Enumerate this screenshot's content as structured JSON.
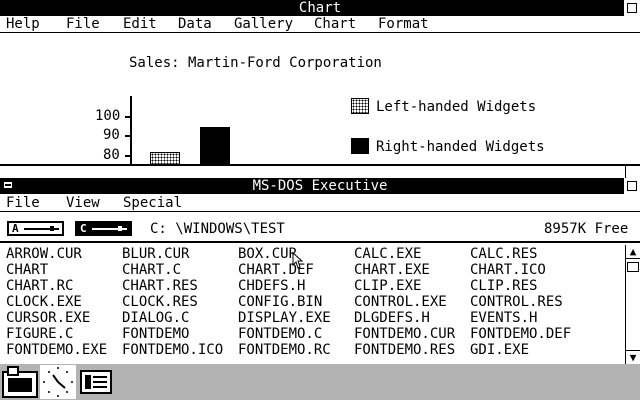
{
  "chart_window": {
    "title": "Chart",
    "menu": [
      "Help",
      "File",
      "Edit",
      "Data",
      "Gallery",
      "Chart",
      "Format"
    ]
  },
  "chart_data": {
    "type": "bar",
    "title": "Sales: Martin-Ford Corporation",
    "yticks": [
      "100",
      "90",
      "80"
    ],
    "series": [
      {
        "name": "Left-handed Widgets",
        "values": [
          81
        ]
      },
      {
        "name": "Right-handed Widgets",
        "values": [
          94
        ]
      }
    ],
    "ylim": [
      75,
      105
    ],
    "legend_position": "right",
    "colors": {
      "Left-handed Widgets": "light dot pattern",
      "Right-handed Widgets": "dense dot pattern"
    }
  },
  "dos_window": {
    "title": "MS-DOS Executive",
    "menu": [
      "File",
      "View",
      "Special"
    ],
    "drives": [
      "A",
      "C"
    ],
    "selected_drive": "C",
    "path": "C: \\WINDOWS\\TEST",
    "free_space": "8957K Free",
    "files": [
      [
        "ARROW.CUR",
        "BLUR.CUR",
        "BOX.CUR",
        "CALC.EXE",
        "CALC.RES"
      ],
      [
        "CHART",
        "CHART.C",
        "CHART.DEF",
        "CHART.EXE",
        "CHART.ICO"
      ],
      [
        "CHART.RC",
        "CHART.RES",
        "CHDEFS.H",
        "CLIP.EXE",
        "CLIP.RES"
      ],
      [
        "CLOCK.EXE",
        "CLOCK.RES",
        "CONFIG.BIN",
        "CONTROL.EXE",
        "CONTROL.RES"
      ],
      [
        "CURSOR.EXE",
        "DIALOG.C",
        "DISPLAY.EXE",
        "DLGDEFS.H",
        "EVENTS.H"
      ],
      [
        "FIGURE.C",
        "FONTDEMO",
        "FONTDEMO.C",
        "FONTDEMO.CUR",
        "FONTDEMO.DEF"
      ],
      [
        "FONTDEMO.EXE",
        "FONTDEMO.ICO",
        "FONTDEMO.RC",
        "FONTDEMO.RES",
        "GDI.EXE"
      ]
    ]
  },
  "icon_bar": {
    "icons": [
      "file-cabinet-icon",
      "clock-icon",
      "ms-dos-executive-icon"
    ]
  }
}
